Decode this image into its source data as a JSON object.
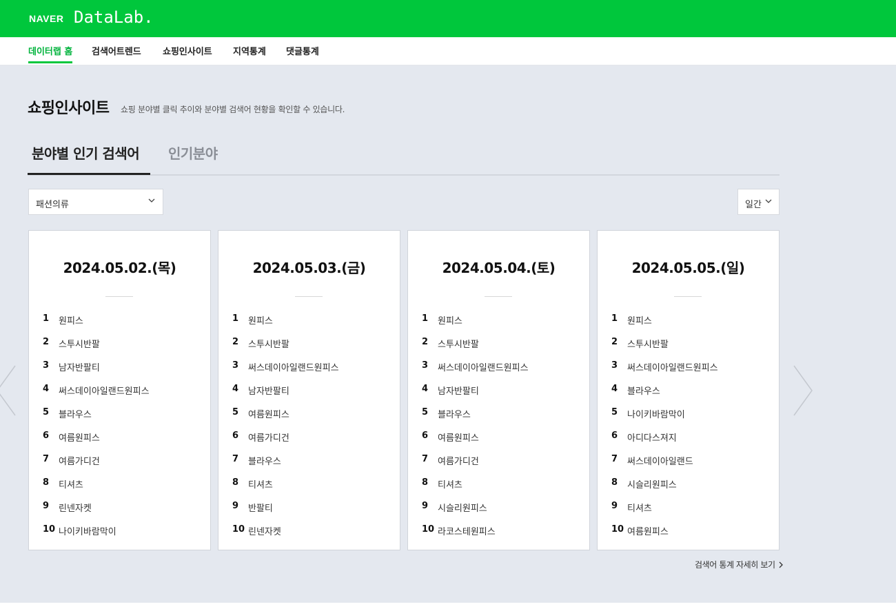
{
  "header": {
    "brand": "NAVER",
    "product": "DataLab.",
    "colors": {
      "brand_green": "#00c73c",
      "page_bg": "#e4e8ef"
    }
  },
  "nav": {
    "items": [
      {
        "label": "데이터랩 홈",
        "active": true
      },
      {
        "label": "검색어트렌드",
        "active": false
      },
      {
        "label": "쇼핑인사이트",
        "active": false
      },
      {
        "label": "지역통계",
        "active": false
      },
      {
        "label": "댓글통계",
        "active": false
      }
    ]
  },
  "page": {
    "title": "쇼핑인사이트",
    "description": "쇼핑 분야별 클릭 추이와 분야별 검색어 현황을 확인할 수 있습니다."
  },
  "tabs": [
    {
      "label": "분야별 인기 검색어",
      "active": true
    },
    {
      "label": "인기분야",
      "active": false
    }
  ],
  "filters": {
    "category": {
      "value": "패션의류",
      "icon": "chevron-down-icon"
    },
    "period": {
      "value": "일간",
      "icon": "chevron-down-icon"
    }
  },
  "cards": [
    {
      "date": "2024.05.02.(목)",
      "ranks": [
        {
          "rank": "1",
          "keyword": "원피스"
        },
        {
          "rank": "2",
          "keyword": "스투시반팔"
        },
        {
          "rank": "3",
          "keyword": "남자반팔티"
        },
        {
          "rank": "4",
          "keyword": "써스데이아일랜드원피스"
        },
        {
          "rank": "5",
          "keyword": "블라우스"
        },
        {
          "rank": "6",
          "keyword": "여름원피스"
        },
        {
          "rank": "7",
          "keyword": "여름가디건"
        },
        {
          "rank": "8",
          "keyword": "티셔츠"
        },
        {
          "rank": "9",
          "keyword": "린넨자켓"
        },
        {
          "rank": "10",
          "keyword": "나이키바람막이"
        }
      ]
    },
    {
      "date": "2024.05.03.(금)",
      "ranks": [
        {
          "rank": "1",
          "keyword": "원피스"
        },
        {
          "rank": "2",
          "keyword": "스투시반팔"
        },
        {
          "rank": "3",
          "keyword": "써스데이아일랜드원피스"
        },
        {
          "rank": "4",
          "keyword": "남자반팔티"
        },
        {
          "rank": "5",
          "keyword": "여름원피스"
        },
        {
          "rank": "6",
          "keyword": "여름가디건"
        },
        {
          "rank": "7",
          "keyword": "블라우스"
        },
        {
          "rank": "8",
          "keyword": "티셔츠"
        },
        {
          "rank": "9",
          "keyword": "반팔티"
        },
        {
          "rank": "10",
          "keyword": "린넨자켓"
        }
      ]
    },
    {
      "date": "2024.05.04.(토)",
      "ranks": [
        {
          "rank": "1",
          "keyword": "원피스"
        },
        {
          "rank": "2",
          "keyword": "스투시반팔"
        },
        {
          "rank": "3",
          "keyword": "써스데이아일랜드원피스"
        },
        {
          "rank": "4",
          "keyword": "남자반팔티"
        },
        {
          "rank": "5",
          "keyword": "블라우스"
        },
        {
          "rank": "6",
          "keyword": "여름원피스"
        },
        {
          "rank": "7",
          "keyword": "여름가디건"
        },
        {
          "rank": "8",
          "keyword": "티셔츠"
        },
        {
          "rank": "9",
          "keyword": "시슬리원피스"
        },
        {
          "rank": "10",
          "keyword": "라코스테원피스"
        }
      ]
    },
    {
      "date": "2024.05.05.(일)",
      "ranks": [
        {
          "rank": "1",
          "keyword": "원피스"
        },
        {
          "rank": "2",
          "keyword": "스투시반팔"
        },
        {
          "rank": "3",
          "keyword": "써스데이아일랜드원피스"
        },
        {
          "rank": "4",
          "keyword": "블라우스"
        },
        {
          "rank": "5",
          "keyword": "나이키바람막이"
        },
        {
          "rank": "6",
          "keyword": "아디다스져지"
        },
        {
          "rank": "7",
          "keyword": "써스데이아일랜드"
        },
        {
          "rank": "8",
          "keyword": "시슬리원피스"
        },
        {
          "rank": "9",
          "keyword": "티셔츠"
        },
        {
          "rank": "10",
          "keyword": "여름원피스"
        }
      ]
    }
  ],
  "carousel": {
    "prev_icon": "chevron-left-icon",
    "next_icon": "chevron-right-icon"
  },
  "footer_link": {
    "label": "검색어 통계 자세히 보기",
    "icon": "chevron-right-icon"
  }
}
